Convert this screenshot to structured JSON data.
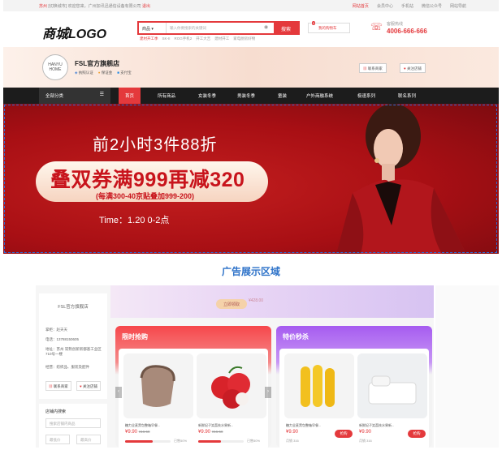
{
  "topbar": {
    "location": "苏州",
    "welcome": "[切换城市]",
    "greeting": "欢迎您来，广州加讯迅通信设备有限公司",
    "logout": "退出",
    "links": [
      "网站首页",
      "会员中心",
      "手机站",
      "微信公众号",
      "网站导航"
    ]
  },
  "header": {
    "logo": "商城LOGO",
    "search_category": "商品",
    "search_placeholder": "输入你要搜索的关键词",
    "search_button": "搜索",
    "hotwords": [
      "建材开工季",
      "SK-II",
      "ROG手机2",
      "开工大吉",
      "建材开工",
      "家电厨房好物"
    ],
    "cart_label": "我的购物车",
    "cart_count": "0",
    "hotline_label": "客服热线",
    "hotline_number": "4006-666-666"
  },
  "shop": {
    "logo_text": "HANYU HOME",
    "name": "FSL官方旗舰店",
    "tags": [
      "执照认证",
      "保证金",
      "支付宝"
    ],
    "contact_button": "联系商家",
    "follow_button": "关注店铺"
  },
  "nav": {
    "all_categories": "全部分类",
    "items": [
      "首页",
      "所有商品",
      "女装冬季",
      "男装冬季",
      "童装",
      "户外商融系统",
      "极速系列",
      "联名系列"
    ]
  },
  "banner": {
    "line1": "前2小时3件88折",
    "line2": "叠双券满999再减320",
    "line3": "(每满300-40京贴叠加999-200)",
    "time": "Time：1.20 0-2点"
  },
  "caption": "广告展示区域",
  "lower": {
    "top_button": "立即领取",
    "top_price": "¥428.00",
    "side": {
      "shop_name": "FSL官方旗舰店",
      "rows": [
        "掌柜：赵天天",
        "电话：13788150605",
        "地址：苏州 常熟创新新都基工业区710号一楼",
        "经营：纺织品、服装及配件"
      ],
      "contact": "联系商家",
      "follow": "关注店铺"
    },
    "search": {
      "title": "店铺内搜索",
      "placeholder": "搜索店铺内商品",
      "min": "最低价",
      "max": "最高价"
    },
    "promos": [
      {
        "title": "限时抢购",
        "products": [
          {
            "name": "糖力全麦黑包整箱早餐...",
            "price": "¥9.90",
            "old": "¥16.58",
            "sold": "已售50%",
            "progress": 0.6
          },
          {
            "name": "新鲜妃子笑荔枝水果新...",
            "price": "¥9.90",
            "old": "¥16.58",
            "sold": "已售50%",
            "progress": 0.5
          }
        ]
      },
      {
        "title": "特价秒杀",
        "products": [
          {
            "name": "糖力全麦黑包整箱早餐...",
            "price": "¥9.90",
            "old": "月销 316",
            "buy": "抢购"
          },
          {
            "name": "新鲜妃子笑荔枝水果新...",
            "price": "¥9.90",
            "old": "月销 316",
            "buy": "抢购"
          }
        ]
      }
    ]
  }
}
